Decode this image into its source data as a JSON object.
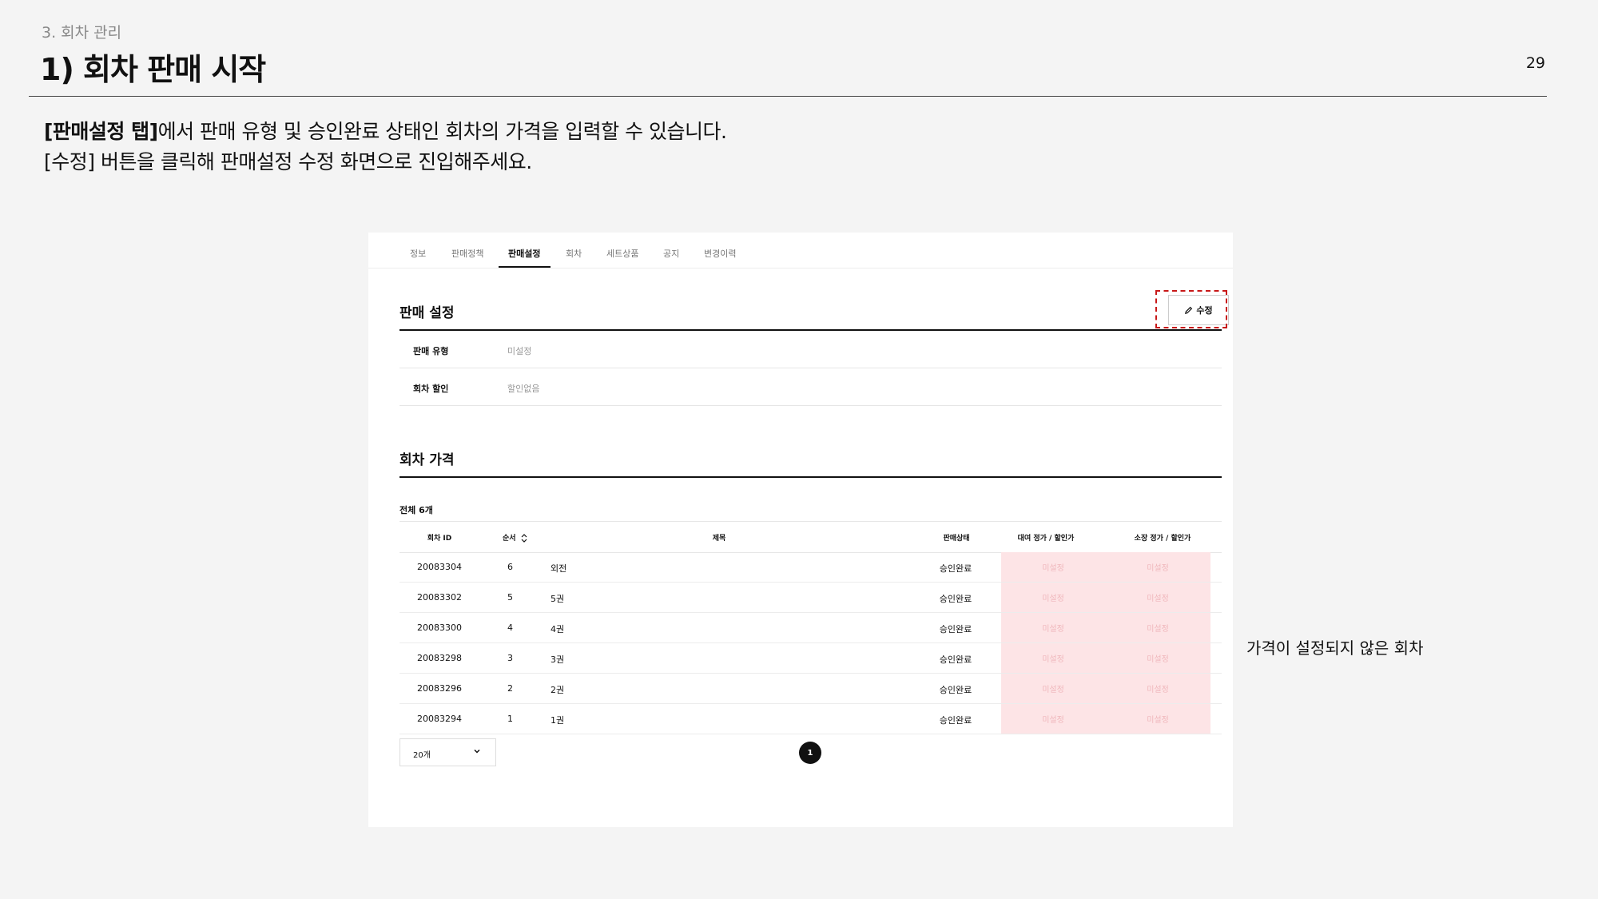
{
  "header": {
    "section_label": "3. 회차 관리",
    "title": "1) 회차 판매 시작",
    "page_number": "29"
  },
  "description": {
    "line1_bold": "[판매설정 탭]",
    "line1_rest": "에서 판매 유형 및 승인완료 상태인 회차의 가격을 입력할 수 있습니다.",
    "line2": "[수정] 버튼을 클릭해 판매설정 수정 화면으로 진입해주세요."
  },
  "side_note": "가격이 설정되지 않은 회차",
  "tabs": [
    {
      "label": "정보",
      "active": false
    },
    {
      "label": "판매정책",
      "active": false
    },
    {
      "label": "판매설정",
      "active": true
    },
    {
      "label": "회차",
      "active": false
    },
    {
      "label": "세트상품",
      "active": false
    },
    {
      "label": "공지",
      "active": false
    },
    {
      "label": "변경이력",
      "active": false
    }
  ],
  "sales_settings": {
    "title": "판매 설정",
    "edit_button": "수정",
    "rows": [
      {
        "label": "판매 유형",
        "value": "미설정"
      },
      {
        "label": "회차 할인",
        "value": "할인없음"
      }
    ]
  },
  "episode_price": {
    "title": "회차 가격",
    "total": "전체 6개",
    "columns": [
      "회차 ID",
      "순서",
      "제목",
      "판매상태",
      "대여 정가 / 할인가",
      "소장 정가 / 할인가"
    ],
    "rows": [
      {
        "id": "20083304",
        "order": "6",
        "title": "외전",
        "status": "승인완료",
        "rent": "미설정",
        "own": "미설정"
      },
      {
        "id": "20083302",
        "order": "5",
        "title": "5권",
        "status": "승인완료",
        "rent": "미설정",
        "own": "미설정"
      },
      {
        "id": "20083300",
        "order": "4",
        "title": "4권",
        "status": "승인완료",
        "rent": "미설정",
        "own": "미설정"
      },
      {
        "id": "20083298",
        "order": "3",
        "title": "3권",
        "status": "승인완료",
        "rent": "미설정",
        "own": "미설정"
      },
      {
        "id": "20083296",
        "order": "2",
        "title": "2권",
        "status": "승인완료",
        "rent": "미설정",
        "own": "미설정"
      },
      {
        "id": "20083294",
        "order": "1",
        "title": "1권",
        "status": "승인완료",
        "rent": "미설정",
        "own": "미설정"
      }
    ],
    "page_size": "20개",
    "current_page": "1"
  },
  "colors": {
    "highlight_border": "#c81818",
    "unset_price_bg": "#fde4e6",
    "unset_price_text": "#f0b7bc"
  }
}
